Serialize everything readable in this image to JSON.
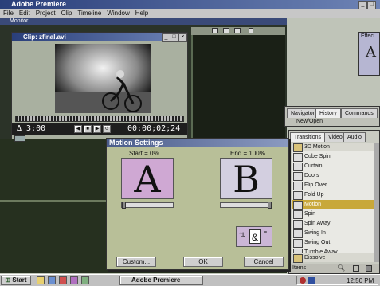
{
  "app": {
    "title": "Adobe Premiere"
  },
  "menu": [
    "File",
    "Edit",
    "Project",
    "Clip",
    "Timeline",
    "Window",
    "Help"
  ],
  "monitor": {
    "title": "Monitor"
  },
  "clip_window": {
    "title": "Clip: zfinal.avi",
    "duration": "Δ 3:00",
    "timecode": "00;00;02;24"
  },
  "effects_panel": {
    "label": "Effec",
    "glyph": "A"
  },
  "history_panel": {
    "tabs": [
      "Navigator",
      "History",
      "Commands"
    ],
    "row": "New/Open"
  },
  "transitions_panel": {
    "tabs": [
      "Transitions",
      "Video",
      "Audio"
    ],
    "folder": "3D Motion",
    "items": [
      "Cube Spin",
      "Curtain",
      "Doors",
      "Flip Over",
      "Fold Up",
      "Motion",
      "Spin",
      "Spin Away",
      "Swing In",
      "Swing Out",
      "Tumble Away"
    ],
    "selected_item": "Motion",
    "next_folder": "Dissolve",
    "status_label": "Items"
  },
  "motion_dialog": {
    "title": "Motion Settings",
    "start_label": "Start = 0%",
    "end_label": "End = 100%",
    "start_letter": "A",
    "end_letter": "B",
    "custom_button": "Custom...",
    "ok_button": "OK",
    "cancel_button": "Cancel"
  },
  "taskbar": {
    "start": "Start",
    "task": "Adobe Premiere",
    "clock": "12:50 PM"
  },
  "colors": {
    "titlebar": "#2a3f7a",
    "dialog": "#b8bf98",
    "preview": "#cfa8d3",
    "selected": "#c8a83a",
    "taskbar": "#c0c0c0"
  }
}
